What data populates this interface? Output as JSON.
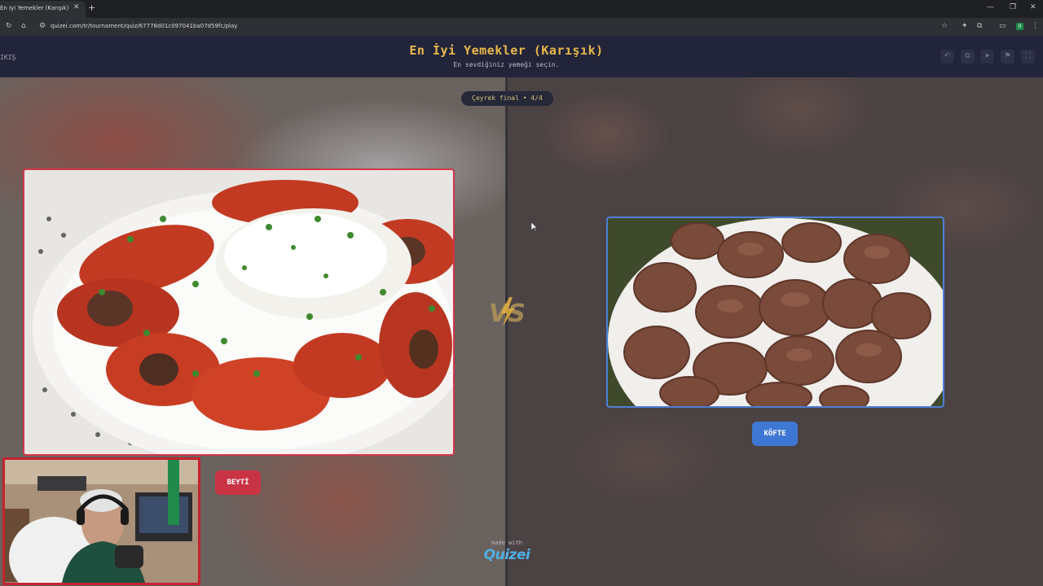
{
  "browser": {
    "tab_title": "En İyi Yemekler (Karışık) - Tier l",
    "tab_close": "✕",
    "new_tab": "+",
    "url": "quizei.com/tr/tournament/quiz/67778d01c097041ba07d59fc/play",
    "nav_reload": "↻",
    "nav_home": "⌂",
    "site_info": "⚙",
    "bookmark_star": "☆",
    "ext_badge": "0",
    "window_minimize": "—",
    "window_maximize": "❐",
    "window_close": "✕",
    "menu": "⋮"
  },
  "header": {
    "exit_label": "IKIŞ",
    "title": "En İyi Yemekler (Karışık)",
    "subtitle": "En sevdiğiniz yemeği seçin.",
    "actions": [
      "undo-icon",
      "copy-icon",
      "share-icon",
      "flag-icon",
      "fullscreen-icon"
    ],
    "action_glyphs": [
      "↶",
      "⧉",
      "➤",
      "⚑",
      "⛶"
    ]
  },
  "match": {
    "round_label": "Çeyrek final • 4/4",
    "vs_label": "VS",
    "left": {
      "name": "BEYTİ",
      "accent": "#d2354a"
    },
    "right": {
      "name": "KÖFTE",
      "accent": "#4f7fd6"
    }
  },
  "footer": {
    "made_with": "made with",
    "brand": "Quizei"
  }
}
